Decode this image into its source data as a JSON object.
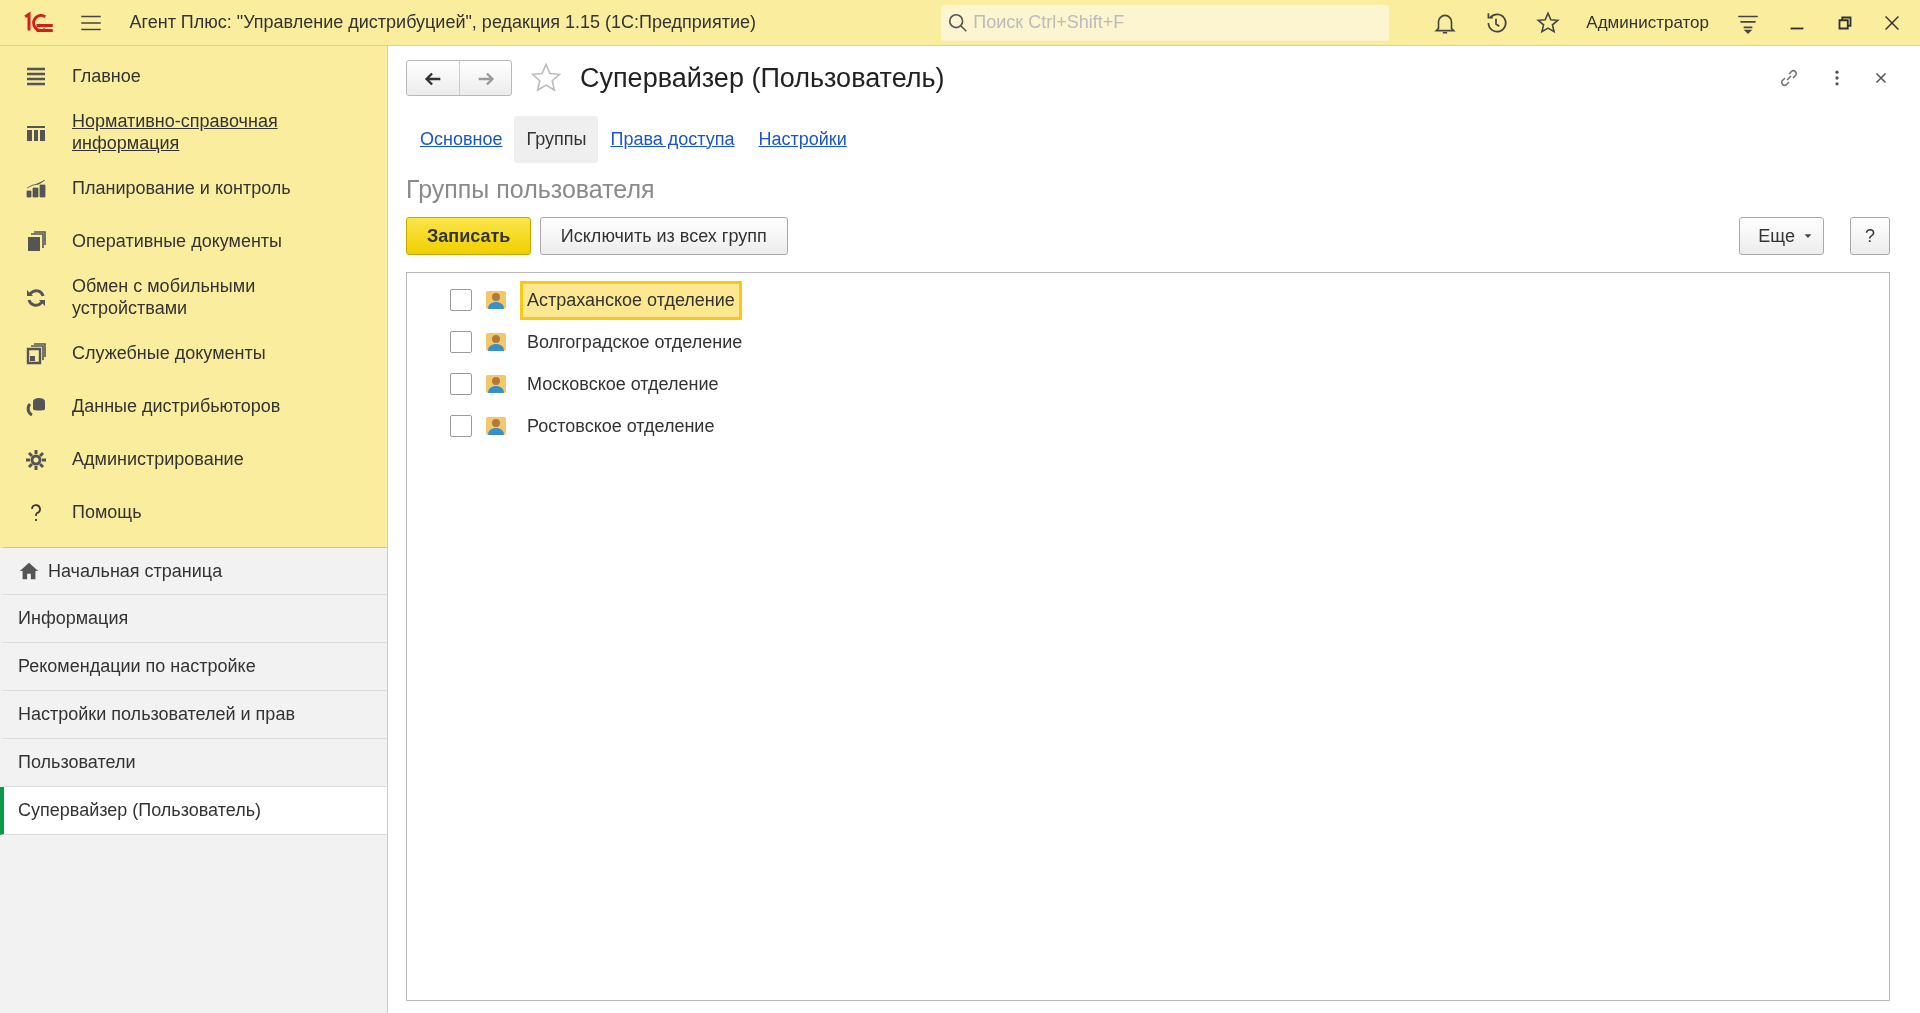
{
  "window": {
    "title": "Агент Плюс: \"Управление дистрибуцией\", редакция 1.15  (1С:Предприятие)",
    "search": {
      "placeholder": "Поиск Ctrl+Shift+F"
    },
    "user": "Администратор"
  },
  "sections": [
    {
      "label": "Главное",
      "hovered": false
    },
    {
      "label": "Нормативно-справочная информация",
      "hovered": true
    },
    {
      "label": "Планирование и контроль",
      "hovered": false
    },
    {
      "label": "Оперативные документы",
      "hovered": false
    },
    {
      "label": "Обмен с мобильными устройствами",
      "hovered": false
    },
    {
      "label": "Служебные документы",
      "hovered": false
    },
    {
      "label": "Данные дистрибьюторов",
      "hovered": false
    },
    {
      "label": "Администрирование",
      "hovered": false
    },
    {
      "label": "Помощь",
      "hovered": false
    }
  ],
  "open_windows": [
    {
      "label": "Начальная страница",
      "kind": "home",
      "selected": false
    },
    {
      "label": "Информация",
      "kind": "page",
      "selected": false
    },
    {
      "label": "Рекомендации по настройке",
      "kind": "page",
      "selected": false
    },
    {
      "label": "Настройки пользователей и прав",
      "kind": "page",
      "selected": false
    },
    {
      "label": "Пользователи",
      "kind": "page",
      "selected": false
    },
    {
      "label": "Супервайзер (Пользователь)",
      "kind": "page",
      "selected": true
    }
  ],
  "form": {
    "title": "Супервайзер (Пользователь)",
    "tabs": [
      {
        "label": "Основное",
        "selected": false
      },
      {
        "label": "Группы",
        "selected": true
      },
      {
        "label": "Права доступа",
        "selected": false
      },
      {
        "label": "Настройки",
        "selected": false
      }
    ],
    "section_title": "Группы пользователя",
    "buttons": {
      "save": "Записать",
      "exclude": "Исключить из всех групп",
      "more": "Еще",
      "help": "?"
    },
    "groups": [
      {
        "label": "Астраханское отделение",
        "checked": false,
        "selected": true
      },
      {
        "label": "Волгоградское отделение",
        "checked": false,
        "selected": false
      },
      {
        "label": "Московское отделение",
        "checked": false,
        "selected": false
      },
      {
        "label": "Ростовское отделение",
        "checked": false,
        "selected": false
      }
    ]
  }
}
